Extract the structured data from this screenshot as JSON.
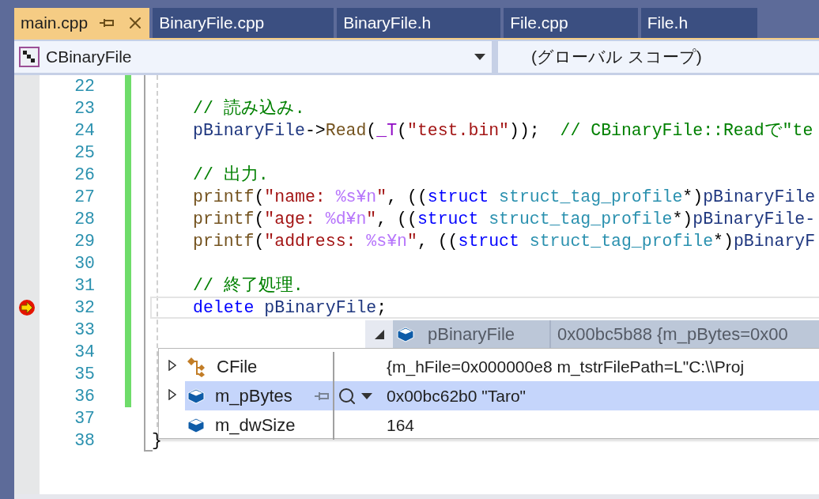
{
  "tabs": [
    {
      "label": "main.cpp",
      "selected": true
    },
    {
      "label": "BinaryFile.cpp",
      "selected": false
    },
    {
      "label": "BinaryFile.h",
      "selected": false
    },
    {
      "label": "File.cpp",
      "selected": false
    },
    {
      "label": "File.h",
      "selected": false
    }
  ],
  "navigation": {
    "type_scope": "CBinaryFile",
    "member_scope": "(グローバル スコープ)"
  },
  "editor": {
    "lines": [
      {
        "number": "22",
        "changed": true,
        "current": false
      },
      {
        "number": "23",
        "changed": true,
        "current": false,
        "indented": true,
        "tokens": [
          {
            "kind": "comment",
            "text": "// 読み込み."
          }
        ]
      },
      {
        "number": "24",
        "changed": true,
        "current": false,
        "indented": true,
        "tokens": [
          {
            "kind": "ident",
            "text": "pBinaryFile"
          },
          {
            "kind": "plain",
            "text": "->"
          },
          {
            "kind": "func",
            "text": "Read"
          },
          {
            "kind": "plain",
            "text": "("
          },
          {
            "kind": "macro",
            "text": "_T"
          },
          {
            "kind": "plain",
            "text": "("
          },
          {
            "kind": "string",
            "text": "\"test.bin\""
          },
          {
            "kind": "plain",
            "text": "));  "
          },
          {
            "kind": "comment",
            "text": "// CBinaryFile::Readで\"te"
          }
        ]
      },
      {
        "number": "25",
        "changed": true,
        "current": false
      },
      {
        "number": "26",
        "changed": true,
        "current": false,
        "indented": true,
        "tokens": [
          {
            "kind": "comment",
            "text": "// 出力."
          }
        ]
      },
      {
        "number": "27",
        "changed": true,
        "current": false,
        "indented": true,
        "tokens": [
          {
            "kind": "func",
            "text": "printf"
          },
          {
            "kind": "plain",
            "text": "("
          },
          {
            "kind": "string",
            "text": "\"name: "
          },
          {
            "kind": "escape",
            "text": "%s¥n"
          },
          {
            "kind": "string",
            "text": "\""
          },
          {
            "kind": "plain",
            "text": ", (("
          },
          {
            "kind": "keyword",
            "text": "struct "
          },
          {
            "kind": "type",
            "text": "struct_tag_profile"
          },
          {
            "kind": "plain",
            "text": "*)"
          },
          {
            "kind": "ident",
            "text": "pBinaryFile"
          }
        ]
      },
      {
        "number": "28",
        "changed": true,
        "current": false,
        "indented": true,
        "tokens": [
          {
            "kind": "func",
            "text": "printf"
          },
          {
            "kind": "plain",
            "text": "("
          },
          {
            "kind": "string",
            "text": "\"age: "
          },
          {
            "kind": "escape",
            "text": "%d¥n"
          },
          {
            "kind": "string",
            "text": "\""
          },
          {
            "kind": "plain",
            "text": ", (("
          },
          {
            "kind": "keyword",
            "text": "struct "
          },
          {
            "kind": "type",
            "text": "struct_tag_profile"
          },
          {
            "kind": "plain",
            "text": "*)"
          },
          {
            "kind": "ident",
            "text": "pBinaryFile-"
          }
        ]
      },
      {
        "number": "29",
        "changed": true,
        "current": false,
        "indented": true,
        "tokens": [
          {
            "kind": "func",
            "text": "printf"
          },
          {
            "kind": "plain",
            "text": "("
          },
          {
            "kind": "string",
            "text": "\"address: "
          },
          {
            "kind": "escape",
            "text": "%s¥n"
          },
          {
            "kind": "string",
            "text": "\""
          },
          {
            "kind": "plain",
            "text": ", (("
          },
          {
            "kind": "keyword",
            "text": "struct "
          },
          {
            "kind": "type",
            "text": "struct_tag_profile"
          },
          {
            "kind": "plain",
            "text": "*)"
          },
          {
            "kind": "ident",
            "text": "pBinaryF"
          }
        ]
      },
      {
        "number": "30",
        "changed": true,
        "current": false
      },
      {
        "number": "31",
        "changed": true,
        "current": false,
        "indented": true,
        "tokens": [
          {
            "kind": "comment",
            "text": "// 終了処理."
          }
        ]
      },
      {
        "number": "32",
        "changed": true,
        "current": true,
        "indented": true,
        "tokens": [
          {
            "kind": "keyword",
            "text": "delete "
          },
          {
            "kind": "ident",
            "text": "pBinaryFile"
          },
          {
            "kind": "plain",
            "text": ";"
          }
        ]
      },
      {
        "number": "33",
        "changed": true,
        "current": false
      },
      {
        "number": "34",
        "changed": true,
        "current": false
      },
      {
        "number": "35",
        "changed": true,
        "current": false
      },
      {
        "number": "36",
        "changed": true,
        "current": false
      },
      {
        "number": "37",
        "changed": false,
        "current": false
      },
      {
        "number": "38",
        "changed": false,
        "current": false,
        "indented": false,
        "tokens": [
          {
            "kind": "plain",
            "text": "}"
          }
        ]
      }
    ]
  },
  "datatip": {
    "name": "pBinaryFile",
    "value": "0x00bc5b88 {m_pBytes=0x00",
    "expanded": true,
    "members": [
      {
        "kind": "base",
        "name": "CFile",
        "value": "{m_hFile=0x000000e8 m_tstrFilePath=L\"C:\\\\Proj",
        "expandable": true,
        "selected": false
      },
      {
        "kind": "field",
        "name": "m_pBytes",
        "value": "0x00bc62b0 \"Taro\"",
        "expandable": true,
        "selected": true
      },
      {
        "kind": "field",
        "name": "m_dwSize",
        "value": "164",
        "expandable": false,
        "selected": false
      }
    ]
  }
}
